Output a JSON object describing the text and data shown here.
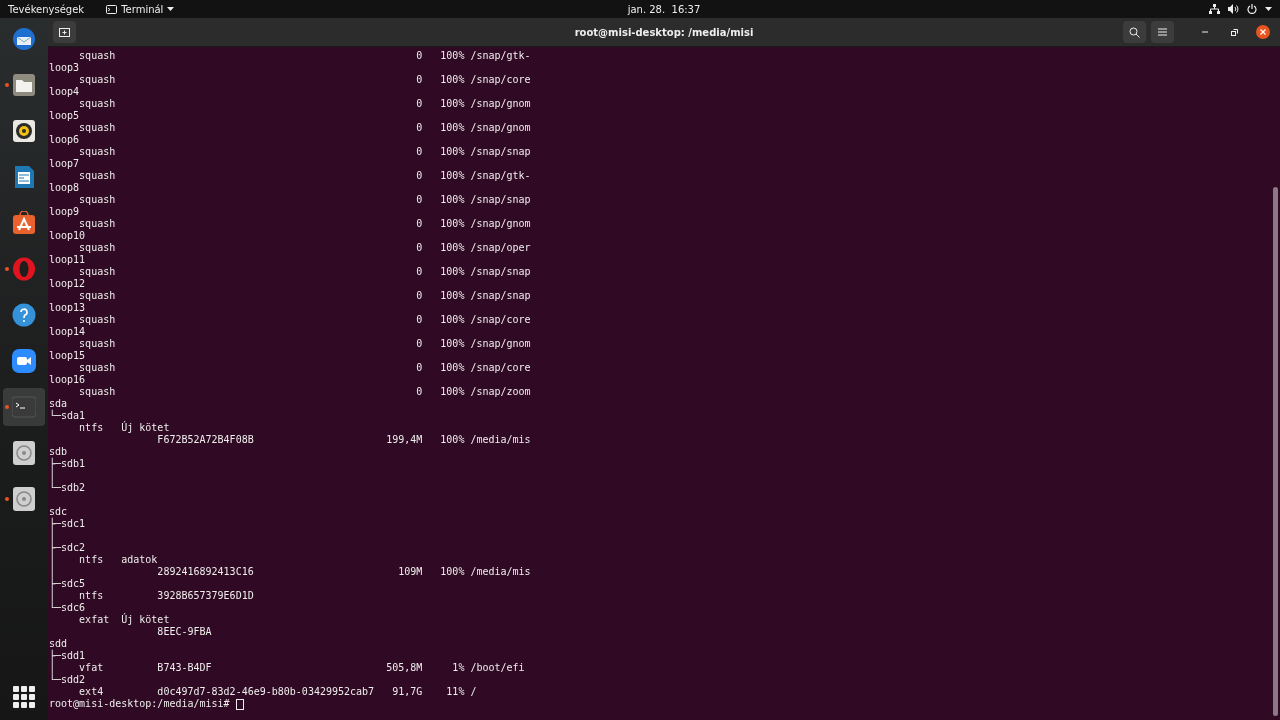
{
  "top_bar": {
    "activities": "Tevékenységek",
    "app_menu": "Terminál",
    "clock": "jan. 28.  16:37"
  },
  "dock": [
    {
      "kind": "mail",
      "running": false,
      "selected": false
    },
    {
      "kind": "files",
      "running": true,
      "selected": false
    },
    {
      "kind": "music",
      "running": false,
      "selected": false
    },
    {
      "kind": "writer",
      "running": false,
      "selected": false
    },
    {
      "kind": "store",
      "running": false,
      "selected": false
    },
    {
      "kind": "browser",
      "running": true,
      "selected": false
    },
    {
      "kind": "help",
      "running": false,
      "selected": false
    },
    {
      "kind": "video",
      "running": false,
      "selected": false
    },
    {
      "kind": "terminal",
      "running": true,
      "selected": true
    },
    {
      "kind": "disk",
      "running": false,
      "selected": false
    },
    {
      "kind": "disk",
      "running": true,
      "selected": false
    }
  ],
  "window": {
    "title": "root@misi-desktop: /media/misi"
  },
  "terminal": {
    "blocks": [
      [
        "     squash                                                  0   100% /snap/gtk-",
        "loop3",
        "     squash                                                  0   100% /snap/core",
        "loop4",
        "     squash                                                  0   100% /snap/gnom",
        "loop5",
        "     squash                                                  0   100% /snap/gnom",
        "loop6",
        "     squash                                                  0   100% /snap/snap",
        "loop7",
        "     squash                                                  0   100% /snap/gtk-",
        "loop8",
        "     squash                                                  0   100% /snap/snap",
        "loop9",
        "     squash                                                  0   100% /snap/gnom",
        "loop10",
        "     squash                                                  0   100% /snap/oper",
        "loop11",
        "     squash                                                  0   100% /snap/snap",
        "loop12",
        "     squash                                                  0   100% /snap/snap",
        "loop13",
        "     squash                                                  0   100% /snap/core",
        "loop14",
        "     squash                                                  0   100% /snap/gnom",
        "loop15",
        "     squash                                                  0   100% /snap/core",
        "loop16",
        "     squash                                                  0   100% /snap/zoom",
        "sda",
        "└─sda1",
        "     ntfs   Új kötet",
        "                  F672B52A72B4F08B                      199,4M   100% /media/mis",
        "sdb",
        "├─sdb1",
        "│",
        "└─sdb2"
      ],
      [
        "sdc",
        "├─sdc1",
        "│",
        "├─sdc2",
        "│    ntfs   adatok",
        "│                 2892416892413C16                        109M   100% /media/mis",
        "├─sdc5",
        "│    ntfs         3928B657379E6D1D",
        "└─sdc6",
        "     exfat  Új kötet",
        "                  8EEC-9FBA",
        "sdd",
        "├─sdd1",
        "│    vfat         B743-B4DF                             505,8M     1% /boot/efi",
        "└─sdd2",
        "     ext4         d0c497d7-83d2-46e9-b80b-03429952cab7   91,7G    11% /"
      ]
    ],
    "prompt": "root@misi-desktop:/media/misi# "
  }
}
